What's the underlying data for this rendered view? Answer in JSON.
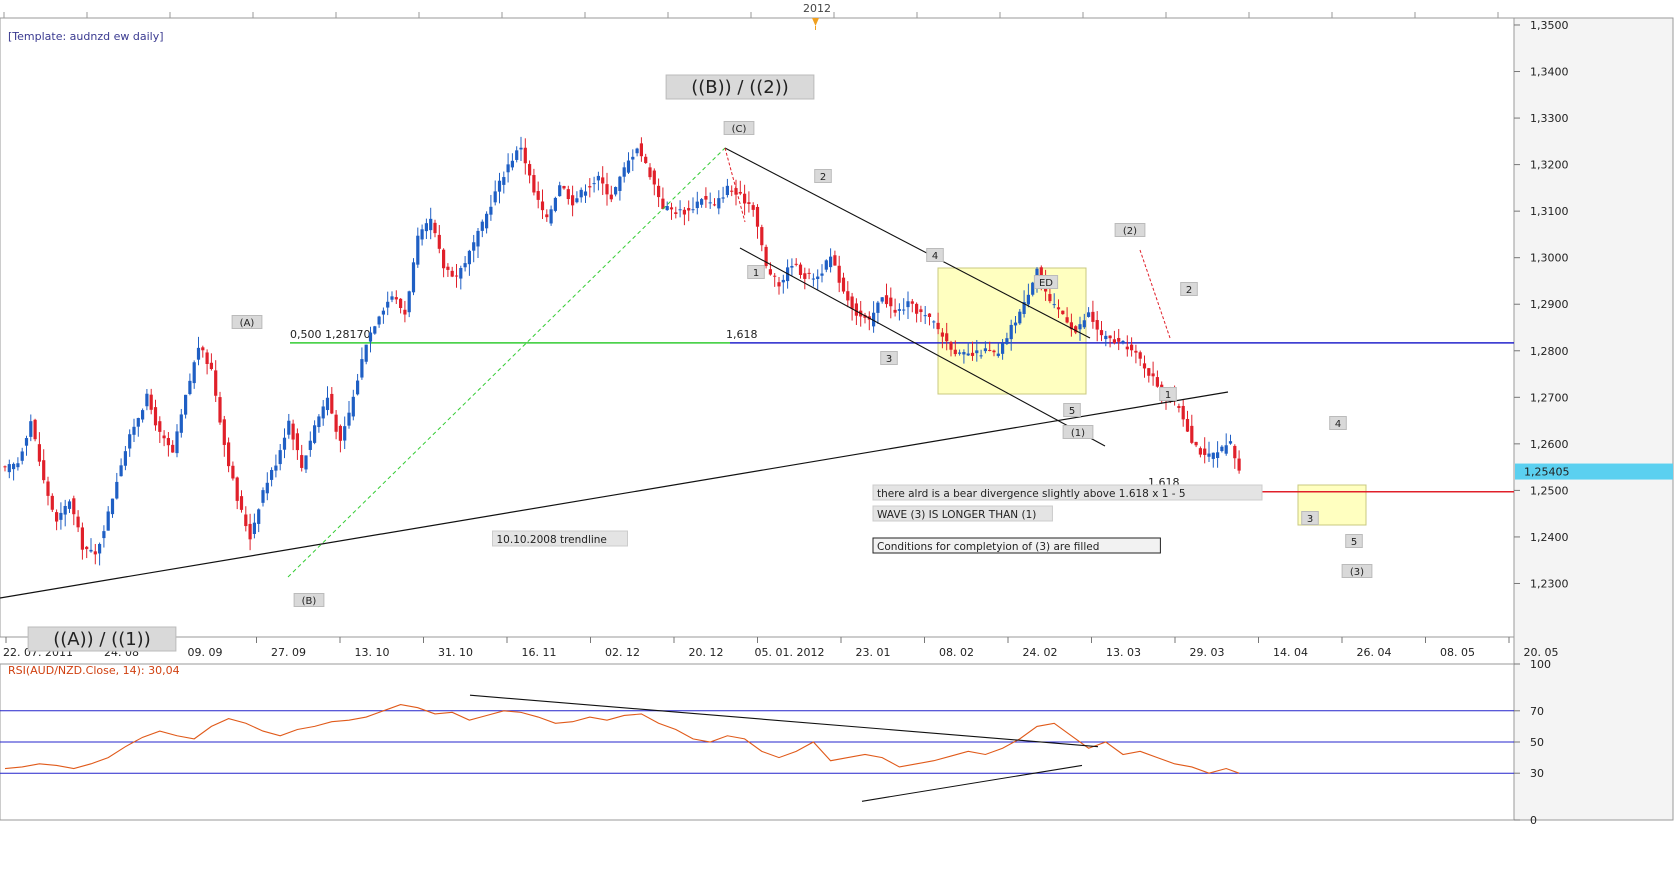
{
  "template_label": "[Template: audnzd ew daily]",
  "year_label": "2012",
  "colors": {
    "up": "#1f5fc4",
    "down": "#e0202a",
    "fib_green": "#33cc33",
    "fib_blue": "#2424cc",
    "fib_red": "#e0202a",
    "rsi": "#e05a1a",
    "box": "#ffffc0",
    "label_bg": "#d9d9d9"
  },
  "chart_data": [
    {
      "type": "candlestick",
      "instrument": "AUD/NZD",
      "timeframe": "daily",
      "x_ticks": [
        "22. 07. 2011",
        "24. 08",
        "09. 09",
        "27. 09",
        "13. 10",
        "31. 10",
        "16. 11",
        "02. 12",
        "20. 12",
        "05. 01. 2012",
        "23. 01",
        "08. 02",
        "24. 02",
        "13. 03",
        "29. 03",
        "14. 04",
        "26. 04",
        "08. 05",
        "20. 05"
      ],
      "y_ticks": [
        "1,3500",
        "1,3400",
        "1,3300",
        "1,3200",
        "1,3100",
        "1,3000",
        "1,2900",
        "1,2800",
        "1,2700",
        "1,2600",
        "1,2500",
        "1,2400",
        "1,2300"
      ],
      "y_range": [
        1.2185,
        1.3515
      ],
      "last_price": "1,25405",
      "price_path": [
        [
          0,
          1.2545
        ],
        [
          3,
          1.256
        ],
        [
          6,
          1.265
        ],
        [
          9,
          1.252
        ],
        [
          12,
          1.243
        ],
        [
          15,
          1.248
        ],
        [
          18,
          1.238
        ],
        [
          21,
          1.236
        ],
        [
          24,
          1.245
        ],
        [
          27,
          1.256
        ],
        [
          30,
          1.264
        ],
        [
          33,
          1.27
        ],
        [
          36,
          1.262
        ],
        [
          39,
          1.258
        ],
        [
          42,
          1.27
        ],
        [
          45,
          1.281
        ],
        [
          48,
          1.276
        ],
        [
          51,
          1.26
        ],
        [
          54,
          1.248
        ],
        [
          57,
          1.24
        ],
        [
          60,
          1.25
        ],
        [
          63,
          1.256
        ],
        [
          66,
          1.265
        ],
        [
          69,
          1.255
        ],
        [
          72,
          1.264
        ],
        [
          75,
          1.27
        ],
        [
          78,
          1.26
        ],
        [
          81,
          1.27
        ],
        [
          84,
          1.282
        ],
        [
          87,
          1.288
        ],
        [
          90,
          1.292
        ],
        [
          93,
          1.288
        ],
        [
          96,
          1.304
        ],
        [
          99,
          1.308
        ],
        [
          102,
          1.298
        ],
        [
          105,
          1.296
        ],
        [
          108,
          1.301
        ],
        [
          111,
          1.307
        ],
        [
          114,
          1.314
        ],
        [
          117,
          1.32
        ],
        [
          120,
          1.324
        ],
        [
          123,
          1.314
        ],
        [
          126,
          1.308
        ],
        [
          129,
          1.316
        ],
        [
          132,
          1.312
        ],
        [
          135,
          1.315
        ],
        [
          138,
          1.317
        ],
        [
          141,
          1.313
        ],
        [
          144,
          1.319
        ],
        [
          147,
          1.324
        ],
        [
          150,
          1.318
        ],
        [
          153,
          1.311
        ],
        [
          156,
          1.31
        ],
        [
          159,
          1.31
        ],
        [
          162,
          1.313
        ],
        [
          165,
          1.311
        ],
        [
          168,
          1.315
        ],
        [
          171,
          1.313
        ],
        [
          174,
          1.311
        ],
        [
          177,
          1.298
        ],
        [
          180,
          1.294
        ],
        [
          183,
          1.299
        ],
        [
          186,
          1.296
        ],
        [
          189,
          1.296
        ],
        [
          192,
          1.3
        ],
        [
          195,
          1.293
        ],
        [
          198,
          1.288
        ],
        [
          201,
          1.286
        ],
        [
          204,
          1.292
        ],
        [
          207,
          1.288
        ],
        [
          210,
          1.29
        ],
        [
          213,
          1.288
        ],
        [
          216,
          1.286
        ],
        [
          219,
          1.282
        ],
        [
          222,
          1.279
        ],
        [
          225,
          1.279
        ],
        [
          228,
          1.28
        ],
        [
          231,
          1.279
        ],
        [
          234,
          1.285
        ],
        [
          237,
          1.29
        ],
        [
          240,
          1.298
        ],
        [
          243,
          1.29
        ],
        [
          246,
          1.288
        ],
        [
          249,
          1.284
        ],
        [
          252,
          1.288
        ],
        [
          255,
          1.283
        ],
        [
          258,
          1.282
        ],
        [
          261,
          1.281
        ],
        [
          264,
          1.278
        ],
        [
          267,
          1.274
        ],
        [
          270,
          1.27
        ],
        [
          273,
          1.268
        ],
        [
          276,
          1.261
        ],
        [
          279,
          1.257
        ],
        [
          282,
          1.258
        ],
        [
          285,
          1.26
        ],
        [
          287,
          1.254
        ]
      ],
      "indices": {
        "1": 0,
        "2": 3,
        "3": 6,
        "4": 9,
        "5": 12,
        "6": 15,
        "7": 18,
        "8": 21,
        "9": 24,
        "10": 27,
        "11": 30,
        "12": 33,
        "13": 36,
        "14": 39,
        "15": 42,
        "16": 45,
        "17": 48,
        "18": 51,
        "19": 54,
        "20": 57,
        "21": 60,
        "22": 63,
        "23": 66,
        "24": 69,
        "25": 72,
        "26": 75,
        "27": 78,
        "28": 81,
        "29": 84,
        "30": 87,
        "31": 90,
        "32": 93,
        "33": 96,
        "34": 99,
        "35": 102,
        "36": 105,
        "37": 108,
        "38": 111,
        "39": 114,
        "40": 117,
        "41": 120,
        "42": 123,
        "43": 126,
        "44": 129,
        "45": 132,
        "46": 135,
        "47": 138,
        "48": 141,
        "49": 144,
        "50": 147,
        "51": 150,
        "52": 153,
        "53": 156,
        "54": 159,
        "55": 162,
        "56": 165,
        "57": 168,
        "58": 171,
        "59": 174,
        "60": 177,
        "61": 180,
        "62": 183,
        "63": 186,
        "64": 189,
        "65": 192,
        "66": 195,
        "67": 198,
        "68": 201,
        "69": 204,
        "70": 207,
        "71": 210,
        "72": 213,
        "73": 216,
        "74": 219,
        "75": 222,
        "76": 225,
        "77": 228,
        "78": 231,
        "79": 234,
        "80": 237,
        "81": 240,
        "82": 243,
        "83": 246,
        "84": 249,
        "85": 252,
        "86": 255,
        "87": 258,
        "88": 261,
        "89": 264,
        "90": 267,
        "91": 270,
        "92": 273,
        "93": 276,
        "94": 279,
        "95": 282,
        "96": 285,
        "97": 287
      },
      "horizontal_lines": [
        {
          "label": "0,500 1,28170",
          "value": 1.2817,
          "color": "#33cc33"
        },
        {
          "label": "1,618",
          "value": 1.2817,
          "color": "#2424cc"
        },
        {
          "label": "1,618",
          "value": 1.2497,
          "color": "#e0202a"
        }
      ],
      "wave_labels": {
        "big": [
          "((B)) / ((2))",
          "((A)) / ((1))"
        ],
        "small": [
          "(A)",
          "(B)",
          "(C)",
          "1",
          "2",
          "3",
          "4",
          "5",
          "ED",
          "(1)",
          "(2)",
          "1",
          "2",
          "3",
          "4",
          "5",
          "(3)"
        ]
      },
      "annotations": [
        "10.10.2008 trendline",
        "there alrd is a bear divergence slightly above 1.618 x 1 - 5",
        "WAVE (3) IS LONGER THAN (1)",
        "Conditions for completyion of (3) are filled"
      ]
    },
    {
      "type": "line",
      "title": "RSI(AUD/NZD.Close, 14): 30,04",
      "y_ticks": [
        "100",
        "70",
        "50",
        "30",
        "0"
      ],
      "y_range": [
        0,
        100
      ],
      "levels": [
        70,
        50,
        30
      ],
      "rsi": [
        [
          0,
          33
        ],
        [
          4,
          34
        ],
        [
          8,
          36
        ],
        [
          12,
          35
        ],
        [
          16,
          33
        ],
        [
          20,
          36
        ],
        [
          24,
          40
        ],
        [
          28,
          47
        ],
        [
          32,
          53
        ],
        [
          36,
          57
        ],
        [
          40,
          54
        ],
        [
          44,
          52
        ],
        [
          48,
          60
        ],
        [
          52,
          65
        ],
        [
          56,
          62
        ],
        [
          60,
          57
        ],
        [
          64,
          54
        ],
        [
          68,
          58
        ],
        [
          72,
          60
        ],
        [
          76,
          63
        ],
        [
          80,
          64
        ],
        [
          84,
          66
        ],
        [
          88,
          70
        ],
        [
          92,
          74
        ],
        [
          96,
          72
        ],
        [
          100,
          68
        ],
        [
          104,
          69
        ],
        [
          108,
          64
        ],
        [
          112,
          67
        ],
        [
          116,
          70
        ],
        [
          120,
          69
        ],
        [
          124,
          66
        ],
        [
          128,
          62
        ],
        [
          132,
          63
        ],
        [
          136,
          66
        ],
        [
          140,
          64
        ],
        [
          144,
          67
        ],
        [
          148,
          68
        ],
        [
          152,
          62
        ],
        [
          156,
          58
        ],
        [
          160,
          52
        ],
        [
          164,
          50
        ],
        [
          168,
          54
        ],
        [
          172,
          52
        ],
        [
          176,
          44
        ],
        [
          180,
          40
        ],
        [
          184,
          44
        ],
        [
          188,
          50
        ],
        [
          192,
          38
        ],
        [
          196,
          40
        ],
        [
          200,
          42
        ],
        [
          204,
          40
        ],
        [
          208,
          34
        ],
        [
          212,
          36
        ],
        [
          216,
          38
        ],
        [
          220,
          41
        ],
        [
          224,
          44
        ],
        [
          228,
          42
        ],
        [
          232,
          46
        ],
        [
          236,
          52
        ],
        [
          240,
          60
        ],
        [
          244,
          62
        ],
        [
          248,
          54
        ],
        [
          252,
          46
        ],
        [
          256,
          50
        ],
        [
          260,
          42
        ],
        [
          264,
          44
        ],
        [
          268,
          40
        ],
        [
          272,
          36
        ],
        [
          276,
          34
        ],
        [
          280,
          30
        ],
        [
          284,
          33
        ],
        [
          287,
          30
        ]
      ]
    }
  ]
}
